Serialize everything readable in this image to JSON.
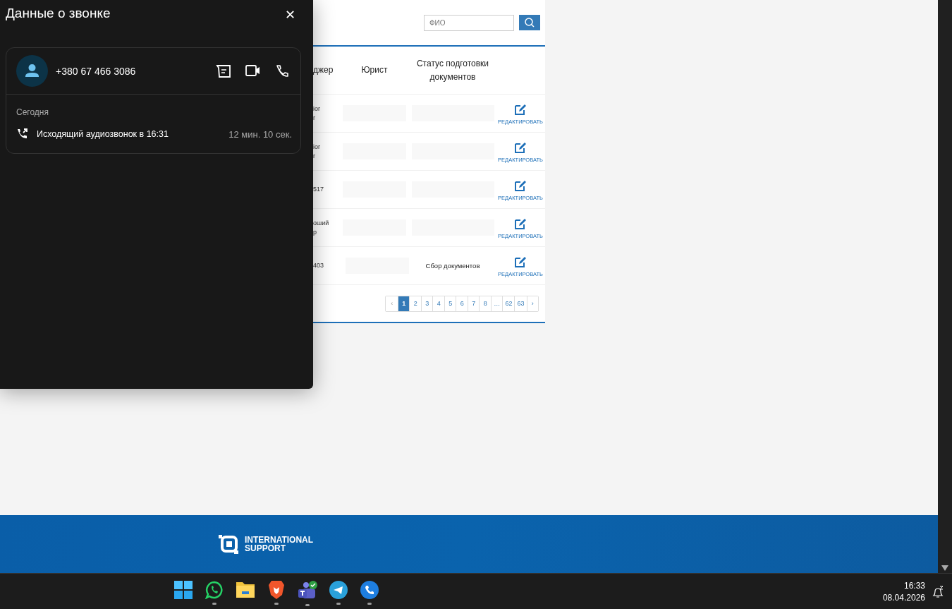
{
  "call_panel": {
    "title": "Данные о звонке",
    "close": "✕",
    "contact": {
      "phone": "+380 67 466 3086"
    },
    "section_label": "Сегодня",
    "calls": [
      {
        "description": "Исходящий аудиозвонок в 16:31",
        "duration": "12 мин. 10 сек."
      }
    ]
  },
  "table": {
    "search": {
      "placeholder": "ФИО"
    },
    "columns": [
      "джер",
      "Юрист",
      "Статус подготовки документов"
    ],
    "rows": [
      {
        "column_1": [
          "ior",
          "r"
        ],
        "status": "",
        "edit": "РЕДАКТИРОВАТЬ"
      },
      {
        "column_1": [
          "ior",
          "r"
        ],
        "status": "",
        "edit": "РЕДАКТИРОВАТЬ"
      },
      {
        "column_1": [
          "517"
        ],
        "status": "",
        "edit": "РЕДАКТИРОВАТЬ"
      },
      {
        "column_1": [
          "оший",
          "р"
        ],
        "status": "",
        "edit": "РЕДАКТИРОВАТЬ"
      },
      {
        "column_1": [
          "403"
        ],
        "status": "Сбор документов",
        "edit": "РЕДАКТИРОВАТЬ"
      }
    ],
    "pagination": {
      "prev": "‹",
      "next": "›",
      "pages": [
        {
          "label": "1",
          "selected": true
        },
        {
          "label": "2",
          "selected": false
        },
        {
          "label": "3",
          "selected": false
        },
        {
          "label": "4",
          "selected": false
        },
        {
          "label": "5",
          "selected": false
        },
        {
          "label": "6",
          "selected": false
        },
        {
          "label": "7",
          "selected": false
        },
        {
          "label": "8",
          "selected": false
        },
        {
          "label": "…",
          "selected": false
        },
        {
          "label": "62",
          "selected": false
        },
        {
          "label": "63",
          "selected": false
        }
      ]
    }
  },
  "footer": {
    "logo_lines": [
      "INTERNATIONAL",
      "SUPPORT"
    ]
  },
  "taskbar": {
    "apps": [
      {
        "kind": "start",
        "running": false
      },
      {
        "kind": "whatsapp",
        "running": true
      },
      {
        "kind": "files",
        "running": false
      },
      {
        "kind": "brave",
        "running": true
      },
      {
        "kind": "teams",
        "running": true
      },
      {
        "kind": "telegram",
        "running": true
      },
      {
        "kind": "phone",
        "running": true
      }
    ],
    "time": "16:33",
    "date": "08.04.2026"
  }
}
